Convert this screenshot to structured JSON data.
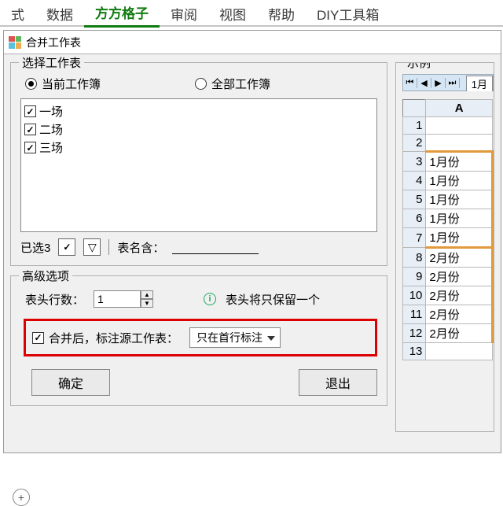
{
  "ribbon": {
    "tabs": [
      "式",
      "数据",
      "方方格子",
      "审阅",
      "视图",
      "帮助",
      "DIY工具箱"
    ],
    "active_index": 2
  },
  "dialog": {
    "title": "合并工作表",
    "select_group_label": "选择工作表",
    "radio_current": "当前工作簿",
    "radio_all": "全部工作簿",
    "sheets": [
      "一场",
      "二场",
      "三场"
    ],
    "selected_count_label": "已选3",
    "name_contains_label": "表名含：",
    "advanced_label": "高级选项",
    "header_rows_label": "表头行数：",
    "header_rows_value": "1",
    "header_note": "表头将只保留一个",
    "mark_source_label": "合并后，标注源工作表：",
    "mark_source_option": "只在首行标注",
    "ok_label": "确定",
    "cancel_label": "退出",
    "example_label": "示例",
    "example_sheet_tab": "1月",
    "grid": {
      "col_header": "A",
      "rows": [
        {
          "n": "1",
          "v": ""
        },
        {
          "n": "2",
          "v": ""
        },
        {
          "n": "3",
          "v": "1月份"
        },
        {
          "n": "4",
          "v": "1月份"
        },
        {
          "n": "5",
          "v": "1月份"
        },
        {
          "n": "6",
          "v": "1月份"
        },
        {
          "n": "7",
          "v": "1月份"
        },
        {
          "n": "8",
          "v": "2月份"
        },
        {
          "n": "9",
          "v": "2月份"
        },
        {
          "n": "10",
          "v": "2月份"
        },
        {
          "n": "11",
          "v": "2月份"
        },
        {
          "n": "12",
          "v": "2月份"
        },
        {
          "n": "13",
          "v": ""
        }
      ]
    }
  }
}
